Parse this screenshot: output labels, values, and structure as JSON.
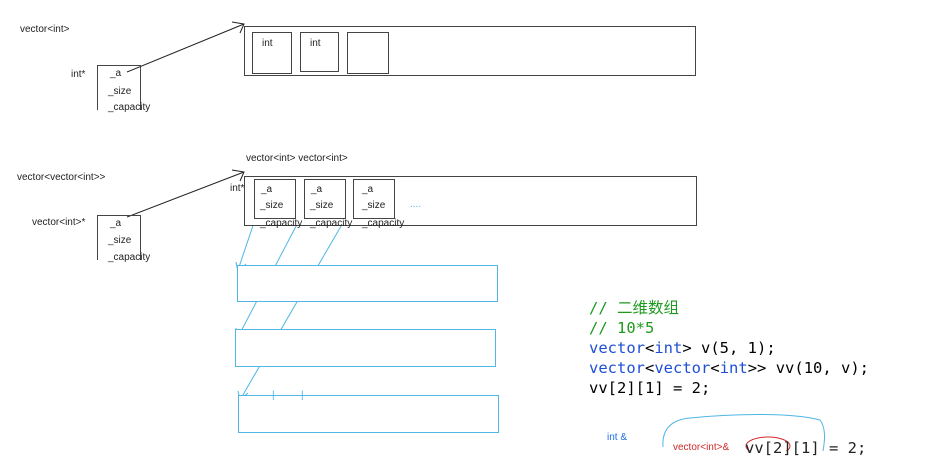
{
  "diagram1": {
    "title": "vector<int>",
    "ptr_type": "int*",
    "fields": [
      "_a",
      "_size",
      "_capacity"
    ],
    "cells": [
      "int",
      "int",
      ""
    ]
  },
  "diagram2": {
    "title": "vector<vector<int>>",
    "array_label": "vector<int> vector<int>",
    "ptr_type": "vector<int>*",
    "inner_ptr_type": "int*",
    "fields": [
      "_a",
      "_size",
      "_capacity"
    ],
    "inner_fields": [
      "_a",
      "_size",
      "_capacity"
    ],
    "ellipsis": "....",
    "tick": "|"
  },
  "code": {
    "comment1": "// 二维数组",
    "comment2": "// 10*5",
    "line3_type": "vector",
    "line3_tmpl": "<",
    "line3_int": "int",
    "line3_rest": "> v(5, 1);",
    "line4_type": "vector",
    "line4_a": "<",
    "line4_type2": "vector",
    "line4_b": "<",
    "line4_int": "int",
    "line4_c": ">> ",
    "line4_vv": "vv",
    "line4_rest": "(10, v);",
    "line5": "vv[2][1] = 2;"
  },
  "annotation": {
    "int_ref": "int &",
    "vector_ref": "vector<int>&",
    "bottom_code": "vv[2][1] = 2;"
  }
}
